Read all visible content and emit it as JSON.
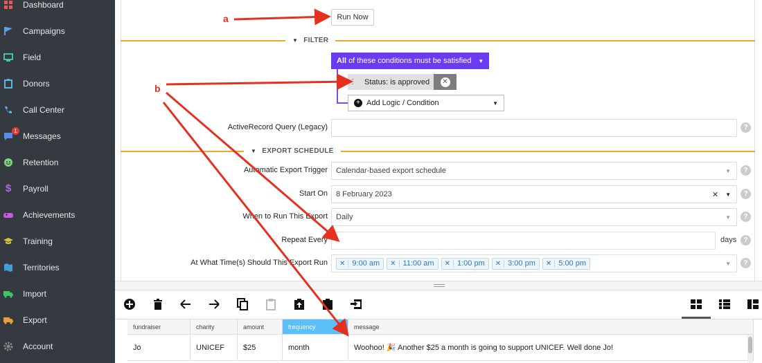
{
  "sidebar": {
    "items": [
      {
        "label": "Dashboard",
        "icon": "dashboard-icon",
        "color": "#e65a5a"
      },
      {
        "label": "Campaigns",
        "icon": "flag-icon",
        "color": "#5aa0e6"
      },
      {
        "label": "Field",
        "icon": "monitor-icon",
        "color": "#3ec7a0"
      },
      {
        "label": "Donors",
        "icon": "clipboard-icon",
        "color": "#5ab4e6"
      },
      {
        "label": "Call Center",
        "icon": "phone-icon",
        "color": "#5ab4e6"
      },
      {
        "label": "Messages",
        "icon": "chat-icon",
        "color": "#5a8ce6",
        "badge": "1"
      },
      {
        "label": "Retention",
        "icon": "smiley-icon",
        "color": "#7cd67c"
      },
      {
        "label": "Payroll",
        "icon": "dollar-icon",
        "color": "#b06ae6"
      },
      {
        "label": "Achievements",
        "icon": "gamepad-icon",
        "color": "#c85ae6"
      },
      {
        "label": "Training",
        "icon": "graduation-cap-icon",
        "color": "#d6c43c"
      },
      {
        "label": "Territories",
        "icon": "map-icon",
        "color": "#3ca0d6"
      },
      {
        "label": "Import",
        "icon": "truck-icon",
        "color": "#3cc46a"
      },
      {
        "label": "Export",
        "icon": "truck-icon",
        "color": "#e6a03c"
      },
      {
        "label": "Account",
        "icon": "gear-icon",
        "color": "#888888"
      }
    ]
  },
  "form": {
    "run_now": "Run Now",
    "filter_section": "FILTER",
    "conditions_head_bold": "All",
    "conditions_head_rest": "of these conditions must be satisfied",
    "condition_chip": "Status: is approved",
    "add_logic": "Add Logic / Condition",
    "query_label": "ActiveRecord Query (Legacy)",
    "query_value": "",
    "export_section": "EXPORT SCHEDULE",
    "trigger_label": "Automatic Export Trigger",
    "trigger_value": "Calendar-based export schedule",
    "start_label": "Start On",
    "start_value": "8 February 2023",
    "when_label": "When to Run This Export",
    "when_value": "Daily",
    "repeat_label": "Repeat Every",
    "repeat_value": "",
    "repeat_suffix": "days",
    "times_label": "At What Time(s) Should This Export Run",
    "times": [
      "9:00 am",
      "11:00 am",
      "1:00 pm",
      "3:00 pm",
      "5:00 pm"
    ],
    "help": "?"
  },
  "toolbar": {
    "icons": [
      "add-icon",
      "delete-icon",
      "arrow-left-icon",
      "arrow-right-icon",
      "copy-icon",
      "paste-icon",
      "upload-icon",
      "clipboard-icon",
      "sign-in-icon"
    ],
    "views": [
      "grid-view-icon",
      "list-view-icon",
      "board-view-icon"
    ]
  },
  "table": {
    "headers": [
      "fundraiser",
      "charity",
      "amount",
      "frequency",
      "message"
    ],
    "rows": [
      [
        "Jo",
        "UNICEF",
        "$25",
        "month",
        "Woohoo! 🎉 Another $25 a month is going to support UNICEF. Well done Jo!"
      ]
    ]
  },
  "annotations": {
    "a": "a",
    "b": "b"
  },
  "colors": {
    "sidebar_bg": "#343a40",
    "accent": "#6a3bf0",
    "section_line": "#f0a72a",
    "arrow": "#e53020",
    "selected_column": "#5bc0f8"
  }
}
